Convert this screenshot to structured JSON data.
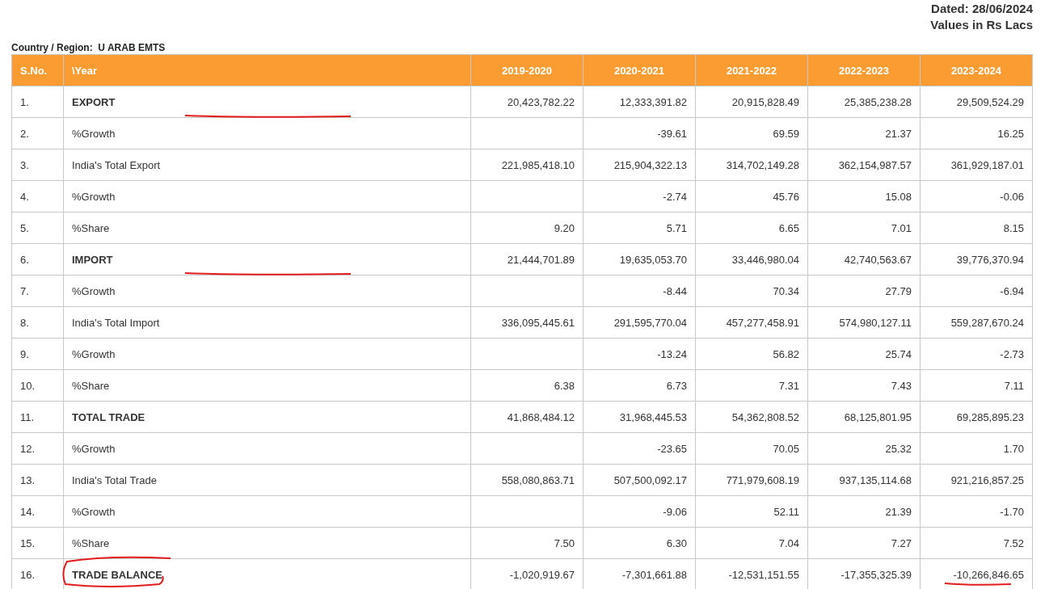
{
  "header": {
    "dated": "Dated: 28/06/2024",
    "units": "Values in Rs Lacs"
  },
  "region": "Country / Region:  U ARAB EMTS",
  "table": {
    "columns": [
      "S.No.",
      "\\Year",
      "2019-2020",
      "2020-2021",
      "2021-2022",
      "2022-2023",
      "2023-2024"
    ],
    "rows": [
      {
        "sno": "1.",
        "label": "EXPORT",
        "bold": true,
        "label_underlined": true,
        "values": [
          "20,423,782.22",
          "12,333,391.82",
          "20,915,828.49",
          "25,385,238.28",
          "29,509,524.29"
        ]
      },
      {
        "sno": "2.",
        "label": "%Growth",
        "bold": false,
        "values": [
          "-39.61",
          "69.59",
          "21.37",
          "16.25"
        ]
      },
      {
        "sno": "3.",
        "label": "India's Total Export",
        "bold": false,
        "values": [
          "221,985,418.10",
          "215,904,322.13",
          "314,702,149.28",
          "362,154,987.57",
          "361,929,187.01"
        ]
      },
      {
        "sno": "4.",
        "label": "%Growth",
        "bold": false,
        "values": [
          "-2.74",
          "45.76",
          "15.08",
          "-0.06"
        ]
      },
      {
        "sno": "5.",
        "label": "%Share",
        "bold": false,
        "values": [
          "9.20",
          "5.71",
          "6.65",
          "7.01",
          "8.15"
        ]
      },
      {
        "sno": "6.",
        "label": "IMPORT",
        "bold": true,
        "label_underlined": true,
        "values": [
          "21,444,701.89",
          "19,635,053.70",
          "33,446,980.04",
          "42,740,563.67",
          "39,776,370.94"
        ]
      },
      {
        "sno": "7.",
        "label": "%Growth",
        "bold": false,
        "values": [
          "-8.44",
          "70.34",
          "27.79",
          "-6.94"
        ]
      },
      {
        "sno": "8.",
        "label": "India's Total Import",
        "bold": false,
        "values": [
          "336,095,445.61",
          "291,595,770.04",
          "457,277,458.91",
          "574,980,127.11",
          "559,287,670.24"
        ]
      },
      {
        "sno": "9.",
        "label": "%Growth",
        "bold": false,
        "values": [
          "-13.24",
          "56.82",
          "25.74",
          "-2.73"
        ]
      },
      {
        "sno": "10.",
        "label": "%Share",
        "bold": false,
        "values": [
          "6.38",
          "6.73",
          "7.31",
          "7.43",
          "7.11"
        ]
      },
      {
        "sno": "11.",
        "label": "TOTAL TRADE",
        "bold": true,
        "values": [
          "41,868,484.12",
          "31,968,445.53",
          "54,362,808.52",
          "68,125,801.95",
          "69,285,895.23"
        ]
      },
      {
        "sno": "12.",
        "label": "%Growth",
        "bold": false,
        "values": [
          "-23.65",
          "70.05",
          "25.32",
          "1.70"
        ]
      },
      {
        "sno": "13.",
        "label": "India's Total Trade",
        "bold": false,
        "values": [
          "558,080,863.71",
          "507,500,092.17",
          "771,979,608.19",
          "937,135,114.68",
          "921,216,857.25"
        ]
      },
      {
        "sno": "14.",
        "label": "%Growth",
        "bold": false,
        "values": [
          "-9.06",
          "52.11",
          "21.39",
          "-1.70"
        ]
      },
      {
        "sno": "15.",
        "label": "%Share",
        "bold": false,
        "values": [
          "7.50",
          "6.30",
          "7.04",
          "7.27",
          "7.52"
        ]
      },
      {
        "sno": "16.",
        "label": "TRADE BALANCE",
        "bold": true,
        "label_circled": true,
        "last_value_underlined": true,
        "values": [
          "-1,020,919.67",
          "-7,301,661.88",
          "-12,531,151.55",
          "-17,355,325.39",
          "-10,266,846.65"
        ]
      }
    ]
  }
}
